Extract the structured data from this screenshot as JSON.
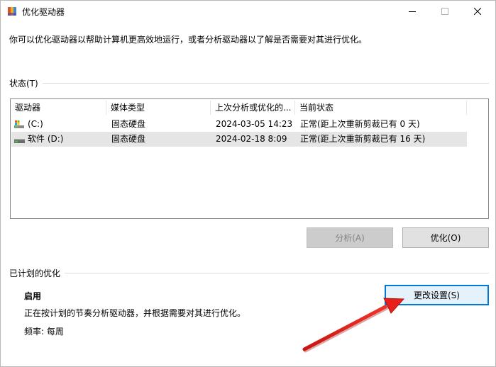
{
  "window": {
    "title": "优化驱动器",
    "icon": "defrag-app-icon"
  },
  "intro_text": "你可以优化驱动器以帮助计算机更高效地运行，或者分析驱动器以了解是否需要对其进行优化。",
  "status_group": {
    "label": "状态(T)",
    "columns": [
      "驱动器",
      "媒体类型",
      "上次分析或优化的...",
      "当前状态"
    ],
    "rows": [
      {
        "drive": "(C:)",
        "media": "固态硬盘",
        "last_run": "2024-03-05 14:23",
        "status": "正常(距上次重新剪裁已有 0 天)",
        "icon": "system-drive-icon",
        "selected": false
      },
      {
        "drive": "软件 (D:)",
        "media": "固态硬盘",
        "last_run": "2024-02-18 8:09",
        "status": "正常(距上次重新剪裁已有 16 天)",
        "icon": "drive-icon",
        "selected": true
      }
    ]
  },
  "buttons": {
    "analyze": "分析(A)",
    "optimize": "优化(O)",
    "change_settings": "更改设置(S)"
  },
  "schedule_group": {
    "label": "已计划的优化",
    "status": "启用",
    "description": "正在按计划的节奏分析驱动器，并根据需要对其进行优化。",
    "frequency": "频率: 每周"
  },
  "colors": {
    "accent": "#0078d7",
    "selection": "#e5e5e5",
    "annotation_arrow": "#e8201c"
  }
}
